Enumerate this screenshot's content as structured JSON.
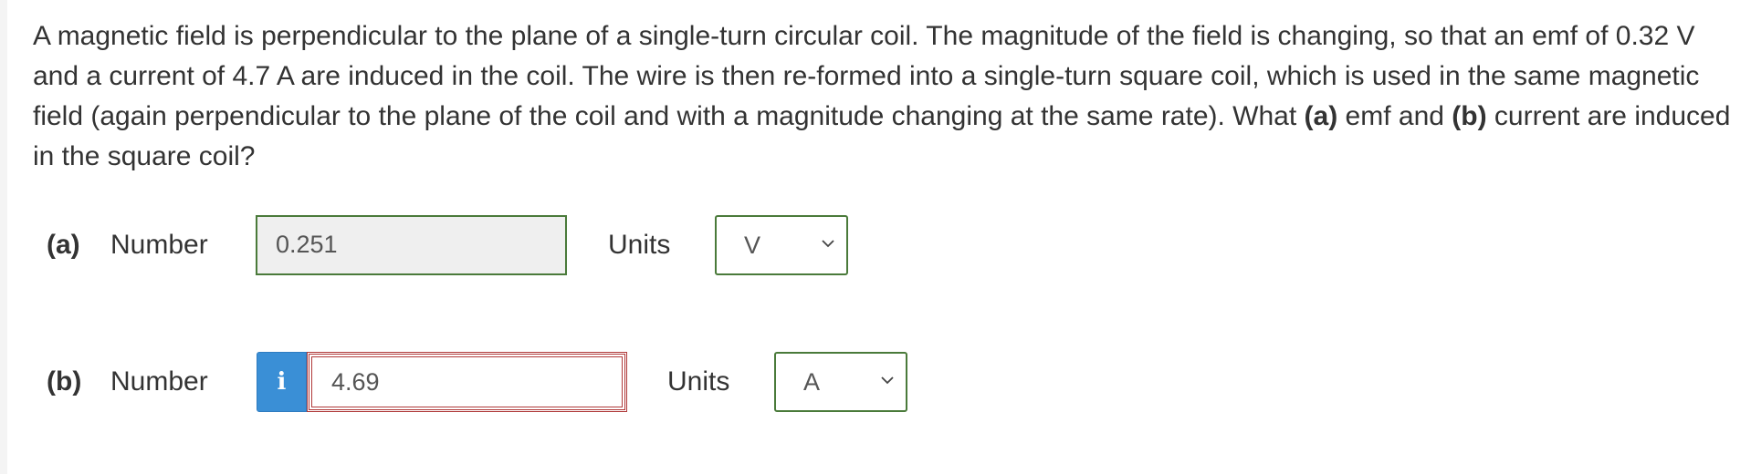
{
  "question": {
    "text_1": "A magnetic field is perpendicular to the plane of a single-turn circular coil. The magnitude of the field is changing, so that an emf of 0.32 V and a current of 4.7 A are induced in the coil. The wire is then re-formed into a single-turn square coil, which is used in the same magnetic field (again perpendicular to the plane of the coil and with a magnitude changing at the same rate). What ",
    "bold_a": "(a)",
    "text_2": " emf and ",
    "bold_b": "(b)",
    "text_3": " current are induced in the square coil?"
  },
  "part_a": {
    "label": "(a)",
    "number_label": "Number",
    "number_value": "0.251",
    "units_label": "Units",
    "units_value": "V"
  },
  "part_b": {
    "label": "(b)",
    "number_label": "Number",
    "info_icon": "i",
    "number_value": "4.69",
    "units_label": "Units",
    "units_value": "A"
  },
  "colors": {
    "correct_border": "#4a7a3a",
    "incorrect_border": "#b03a3a",
    "info_button": "#3a8fd6"
  }
}
